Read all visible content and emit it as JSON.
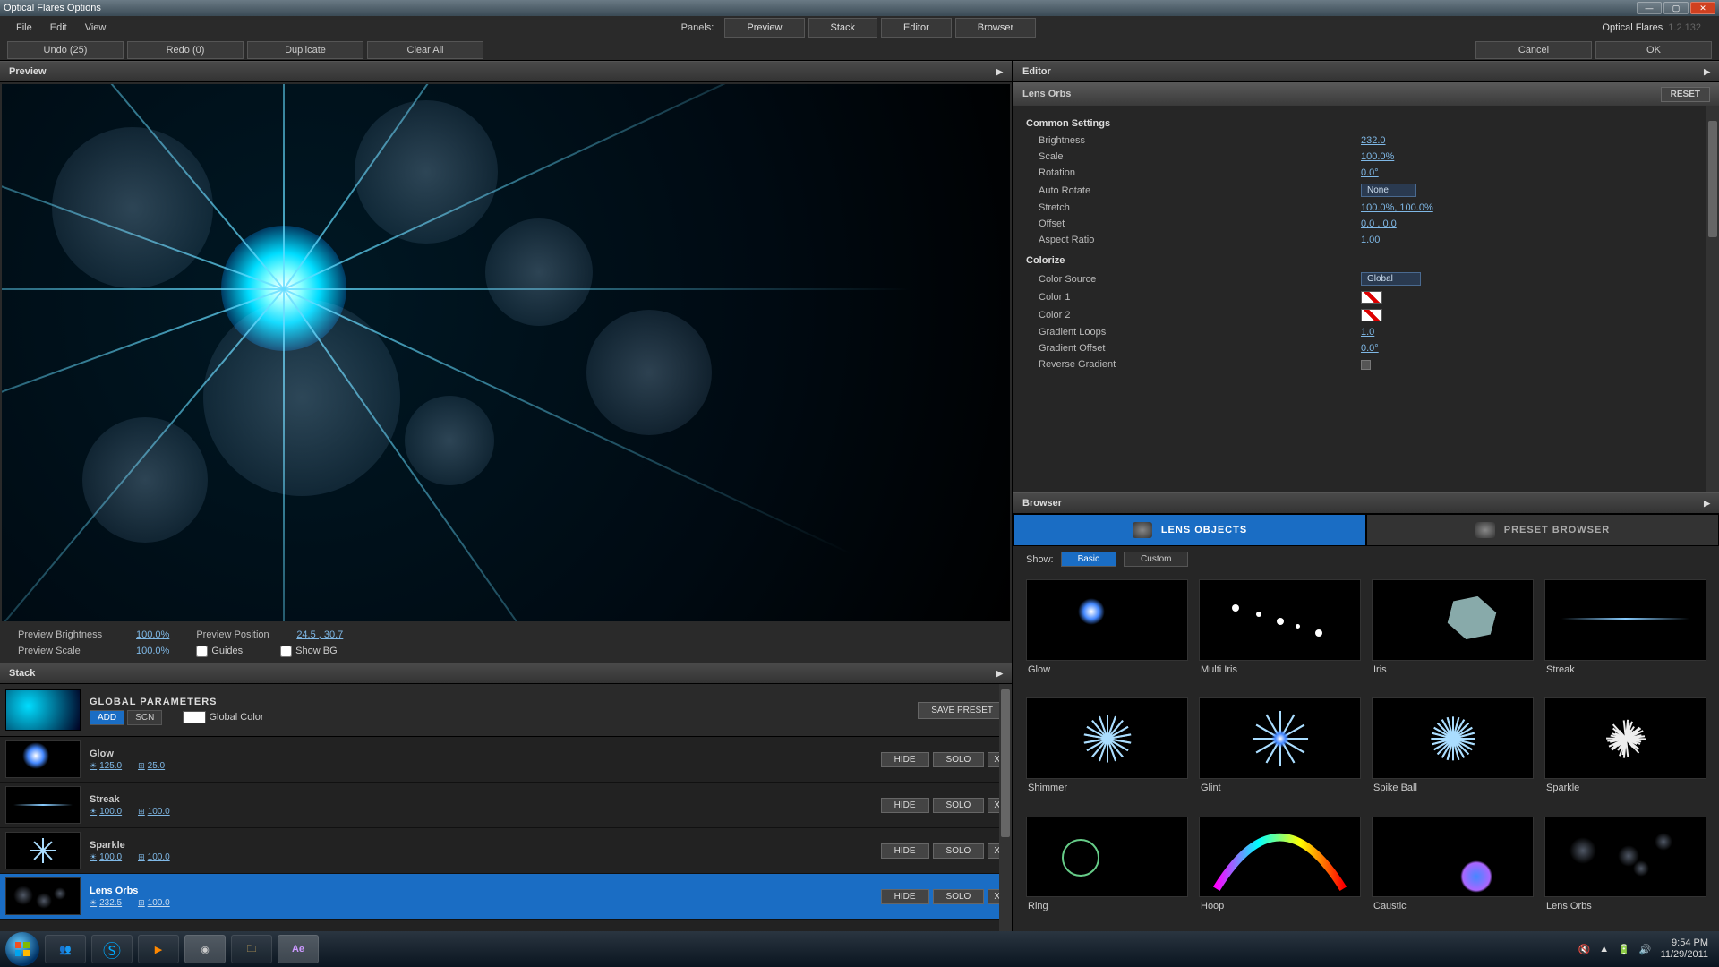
{
  "title": "Optical Flares Options",
  "menubar": [
    "File",
    "Edit",
    "View"
  ],
  "panels_label": "Panels:",
  "panel_tabs": [
    "Preview",
    "Stack",
    "Editor",
    "Browser"
  ],
  "brand": {
    "name": "Optical Flares",
    "version": "1.2.132"
  },
  "topbtns": {
    "undo": "Undo (25)",
    "redo": "Redo (0)",
    "duplicate": "Duplicate",
    "clearall": "Clear All",
    "cancel": "Cancel",
    "ok": "OK"
  },
  "preview": {
    "header": "Preview",
    "brightness_label": "Preview Brightness",
    "brightness_value": "100.0%",
    "scale_label": "Preview Scale",
    "scale_value": "100.0%",
    "position_label": "Preview Position",
    "position_value": "24.5 , 30.7",
    "guides_label": "Guides",
    "showbg_label": "Show BG"
  },
  "stack": {
    "header": "Stack",
    "global_title": "GLOBAL PARAMETERS",
    "add": "ADD",
    "scn": "SCN",
    "global_color": "Global Color",
    "save_preset": "SAVE PRESET",
    "hide": "HIDE",
    "solo": "SOLO",
    "x": "X",
    "items": [
      {
        "name": "Glow",
        "v1": "125.0",
        "v2": "25.0",
        "selected": false
      },
      {
        "name": "Streak",
        "v1": "100.0",
        "v2": "100.0",
        "selected": false
      },
      {
        "name": "Sparkle",
        "v1": "100.0",
        "v2": "100.0",
        "selected": false
      },
      {
        "name": "Lens Orbs",
        "v1": "232.5",
        "v2": "100.0",
        "selected": true
      }
    ]
  },
  "editor": {
    "header": "Editor",
    "object_name": "Lens Orbs",
    "reset": "RESET",
    "sections": {
      "common": "Common Settings",
      "colorize": "Colorize"
    },
    "rows": {
      "brightness": {
        "label": "Brightness",
        "value": "232.0"
      },
      "scale": {
        "label": "Scale",
        "value": "100.0%"
      },
      "rotation": {
        "label": "Rotation",
        "value": "0.0°"
      },
      "autorotate": {
        "label": "Auto Rotate",
        "value": "None"
      },
      "stretch": {
        "label": "Stretch",
        "value": "100.0%, 100.0%"
      },
      "offset": {
        "label": "Offset",
        "value": "0.0 , 0.0"
      },
      "aspect": {
        "label": "Aspect Ratio",
        "value": "1.00"
      },
      "colorsource": {
        "label": "Color Source",
        "value": "Global"
      },
      "color1": {
        "label": "Color 1"
      },
      "color2": {
        "label": "Color 2"
      },
      "gradloops": {
        "label": "Gradient Loops",
        "value": "1.0"
      },
      "gradoffset": {
        "label": "Gradient Offset",
        "value": "0.0°"
      },
      "revgrad": {
        "label": "Reverse Gradient"
      }
    }
  },
  "browser": {
    "header": "Browser",
    "tabs": {
      "objects": "LENS OBJECTS",
      "presets": "PRESET BROWSER"
    },
    "show": "Show:",
    "basic": "Basic",
    "custom": "Custom",
    "items": [
      "Glow",
      "Multi Iris",
      "Iris",
      "Streak",
      "Shimmer",
      "Glint",
      "Spike Ball",
      "Sparkle",
      "Ring",
      "Hoop",
      "Caustic",
      "Lens Orbs"
    ]
  },
  "taskbar": {
    "time": "9:54 PM",
    "date": "11/29/2011"
  }
}
